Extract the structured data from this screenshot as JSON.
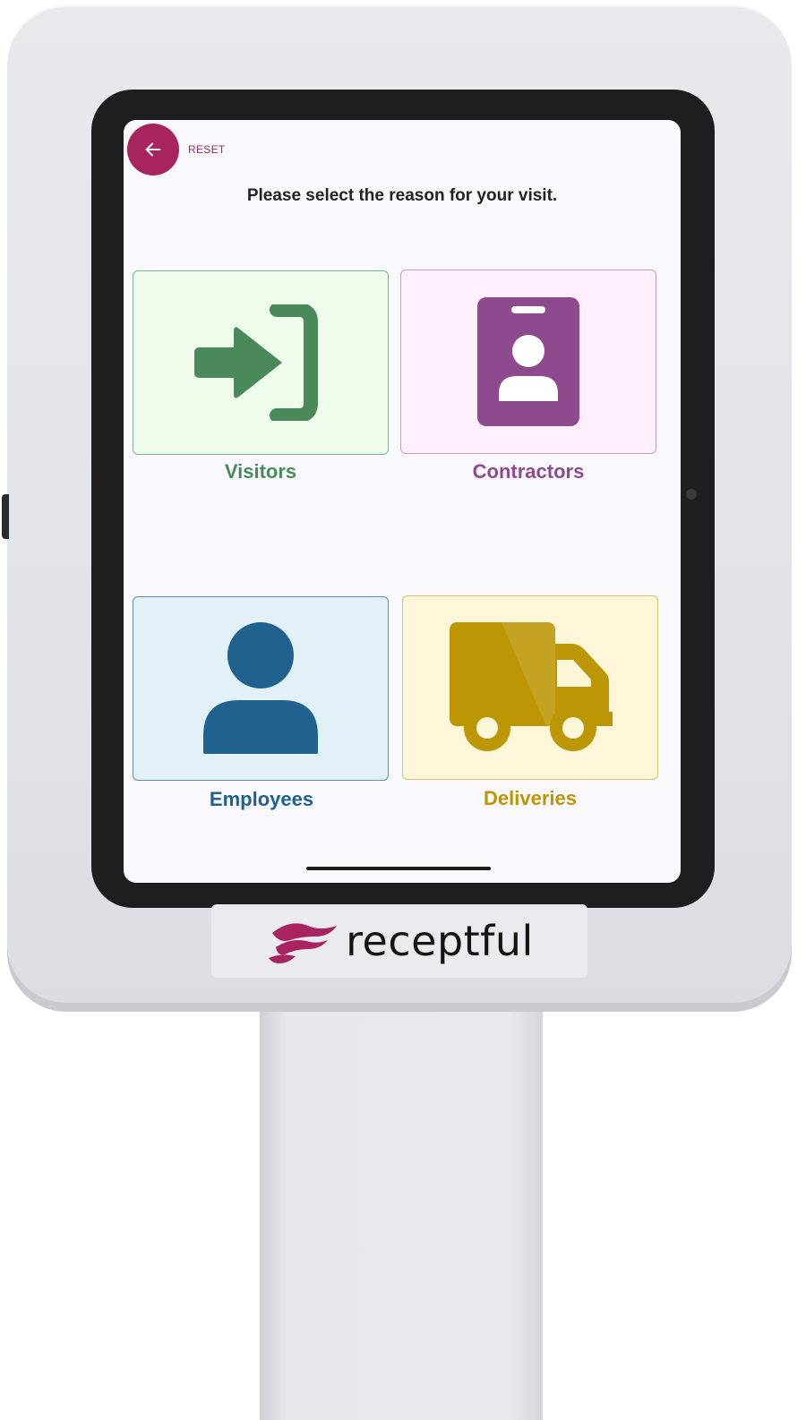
{
  "header": {
    "reset_label": "RESET",
    "prompt": "Please select the reason for your visit."
  },
  "options": [
    {
      "label": "Visitors",
      "icon": "sign-in-icon",
      "color": "#4a8a5a",
      "tile_bg": "#eefbea",
      "border": "#7fb58c"
    },
    {
      "label": "Contractors",
      "icon": "id-badge-icon",
      "color": "#8e4a8f",
      "tile_bg": "#fdeffc",
      "border": "#c79ac8"
    },
    {
      "label": "Employees",
      "icon": "user-icon",
      "color": "#20628d",
      "tile_bg": "#e2f0f8",
      "border": "#5f8fae"
    },
    {
      "label": "Deliveries",
      "icon": "truck-icon",
      "color": "#bc9604",
      "tile_bg": "#fdf6d8",
      "border": "#d8c070"
    }
  ],
  "brand": {
    "name": "receptful",
    "accent": "#a8245f"
  }
}
